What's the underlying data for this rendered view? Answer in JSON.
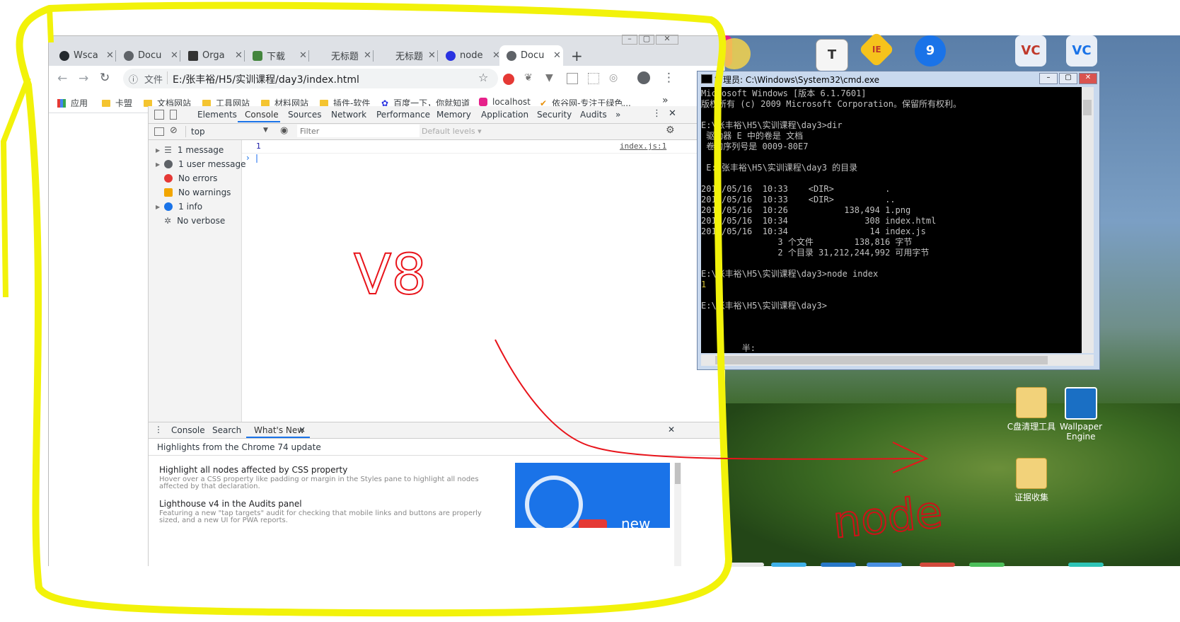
{
  "browser": {
    "tabs": [
      {
        "label": "Wsca",
        "icon": "github-icon",
        "color": "#24292e"
      },
      {
        "label": "Docu",
        "icon": "globe-icon",
        "color": "#5f6368"
      },
      {
        "label": "Orga",
        "icon": "gr-icon",
        "color": "#333333"
      },
      {
        "label": "下载",
        "icon": "node-icon",
        "color": "#43853d"
      },
      {
        "label": "无标题",
        "icon": "none",
        "color": "#dee1e6"
      },
      {
        "label": "无标题",
        "icon": "none",
        "color": "#dee1e6"
      },
      {
        "label": "node",
        "icon": "baidu-icon",
        "color": "#2932e1"
      },
      {
        "label": "Docu",
        "icon": "globe-icon",
        "color": "#5f6368"
      }
    ],
    "new_tab": "+",
    "address": {
      "scheme_label": "文件",
      "url": "E:/张丰裕/H5/实训课程/day3/index.html"
    },
    "bookmarks": [
      {
        "label": "应用",
        "icon": "apps-icon"
      },
      {
        "label": "卡盟",
        "icon": "folder-icon"
      },
      {
        "label": "文档网站",
        "icon": "folder-icon"
      },
      {
        "label": "工具网站",
        "icon": "folder-icon"
      },
      {
        "label": "材料网站",
        "icon": "folder-icon"
      },
      {
        "label": "插件-软件",
        "icon": "folder-icon"
      },
      {
        "label": "百度一下，你就知道",
        "icon": "baidu-icon"
      },
      {
        "label": "localhost",
        "icon": "localhost-icon"
      },
      {
        "label": "依谷网-专注于绿色...",
        "icon": "yigu-icon"
      }
    ],
    "bookmarks_more": "»"
  },
  "devtools": {
    "tabs": [
      "Elements",
      "Console",
      "Sources",
      "Network",
      "Performance",
      "Memory",
      "Application",
      "Security",
      "Audits"
    ],
    "more_tabs": "»",
    "context": "top",
    "filter_placeholder": "Filter",
    "levels": "Default levels ▾",
    "sidebar": [
      {
        "label": "1 message",
        "color": "#5f6368"
      },
      {
        "label": "1 user message",
        "color": "#5f6368"
      },
      {
        "label": "No errors",
        "color": "#e53935"
      },
      {
        "label": "No warnings",
        "color": "#f2a600"
      },
      {
        "label": "1 info",
        "color": "#1a73e8"
      },
      {
        "label": "No verbose",
        "color": "#5f6368"
      }
    ],
    "console_output": {
      "value": "1",
      "source": "index.js:1"
    },
    "prompt": "›",
    "drawer": {
      "tabs": [
        "Console",
        "Search",
        "What's New"
      ],
      "close_tab": "×",
      "heading": "Highlights from the Chrome 74 update",
      "items": [
        {
          "title": "Highlight all nodes affected by CSS property",
          "desc": "Hover over a CSS property like padding or margin in the Styles pane to highlight all nodes affected by that declaration."
        },
        {
          "title": "Lighthouse v4 in the Audits panel",
          "desc": "Featuring a new \"tap targets\" audit for checking that mobile links and buttons are properly sized, and a new UI for PWA reports."
        }
      ],
      "video_text": "new"
    }
  },
  "cmd": {
    "title": "管理员: C:\\Windows\\System32\\cmd.exe",
    "lines": [
      "Microsoft Windows [版本 6.1.7601]",
      "版权所有 (c) 2009 Microsoft Corporation。保留所有权利。",
      "",
      "E:\\张丰裕\\H5\\实训课程\\day3>dir",
      " 驱动器 E 中的卷是 文档",
      " 卷的序列号是 0009-80E7",
      "",
      " E:\\张丰裕\\H5\\实训课程\\day3 的目录",
      "",
      "2019/05/16  10:33    <DIR>          .",
      "2019/05/16  10:33    <DIR>          ..",
      "2019/05/16  10:26           138,494 1.png",
      "2019/05/16  10:34               308 index.html",
      "2019/05/16  10:34                14 index.js",
      "               3 个文件        138,816 字节",
      "               2 个目录 31,212,244,992 可用字节",
      "",
      "E:\\张丰裕\\H5\\实训课程\\day3>node index",
      "1",
      "",
      "E:\\张丰裕\\H5\\实训课程\\day3>",
      "",
      "",
      "",
      "        半:"
    ]
  },
  "desktop": {
    "icons": [
      {
        "label": "C盘清理工具",
        "icon": "folder-icon"
      },
      {
        "label": "Wallpaper Engine",
        "icon": "wallpaper-engine-icon"
      },
      {
        "label": "证据收集",
        "icon": "folder-icon"
      }
    ],
    "top_icons": [
      {
        "label": "T",
        "color": "#f5f5f5",
        "name": "text-tool-icon"
      },
      {
        "label": "IE",
        "color": "#f6c31c",
        "name": "ietester-icon"
      },
      {
        "label": "9",
        "color": "#1a73e8",
        "name": "map-pin-icon"
      },
      {
        "label": "VC",
        "color": "#e8eef7",
        "name": "vc-icon"
      },
      {
        "label": "VC",
        "color": "#e8eef7",
        "name": "vc2-icon"
      }
    ]
  },
  "annotations": {
    "left_text": "V8",
    "right_text": "node"
  }
}
